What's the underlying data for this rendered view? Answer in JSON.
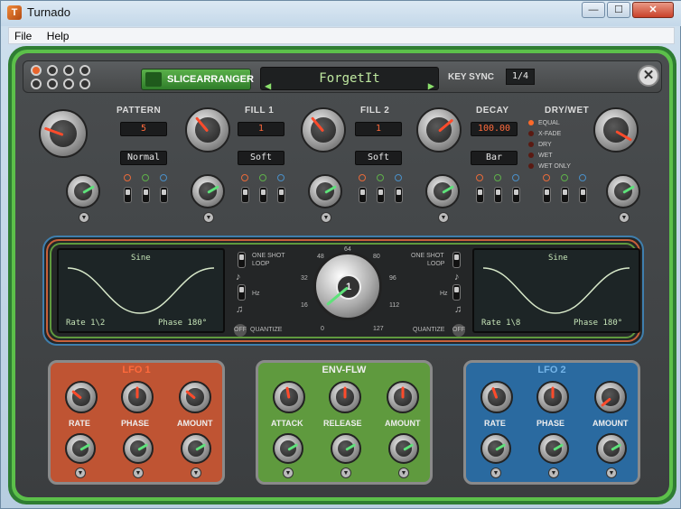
{
  "window": {
    "title": "Turnado",
    "minimize": "—",
    "maximize": "☐",
    "close": "✕"
  },
  "menu": [
    "File",
    "Help"
  ],
  "header": {
    "effect_name": "SLICEARRANGER",
    "preset": "ForgetIt",
    "key_sync_label": "KEY SYNC",
    "key_sync_value": "1/4"
  },
  "fx": {
    "pattern": {
      "label": "PATTERN",
      "value": "5",
      "mode": "Normal"
    },
    "fill1": {
      "label": "FILL 1",
      "value": "1",
      "mode": "Soft"
    },
    "fill2": {
      "label": "FILL 2",
      "value": "1",
      "mode": "Soft"
    },
    "decay": {
      "label": "DECAY",
      "value": "100.00",
      "mode": "Bar"
    },
    "drywet": {
      "label": "DRY/WET",
      "options": [
        "EQUAL",
        "X-FADE",
        "DRY",
        "WET",
        "WET ONLY"
      ],
      "selected": "EQUAL"
    }
  },
  "lfo_display": {
    "left": {
      "shape": "Sine",
      "rate": "Rate   1\\2",
      "phase": "Phase 180°"
    },
    "right": {
      "shape": "Sine",
      "rate": "Rate   1\\8",
      "phase": "Phase 180°"
    },
    "one_shot": "ONE SHOT",
    "loop": "LOOP",
    "hz": "Hz",
    "quantize": "QUANTIZE",
    "off": "OFF"
  },
  "dial": {
    "value": "1",
    "scale": [
      "0",
      "16",
      "32",
      "48",
      "64",
      "80",
      "96",
      "112",
      "127"
    ]
  },
  "mod": {
    "lfo1": {
      "title": "LFO 1",
      "knobs": [
        "RATE",
        "PHASE",
        "AMOUNT"
      ]
    },
    "envflw": {
      "title": "ENV-FLW",
      "knobs": [
        "ATTACK",
        "RELEASE",
        "AMOUNT"
      ]
    },
    "lfo2": {
      "title": "LFO 2",
      "knobs": [
        "RATE",
        "PHASE",
        "AMOUNT"
      ]
    }
  },
  "colors": {
    "accent_orange": "#ff6a3c",
    "accent_green": "#5cc04a",
    "accent_blue": "#3f7fae"
  }
}
